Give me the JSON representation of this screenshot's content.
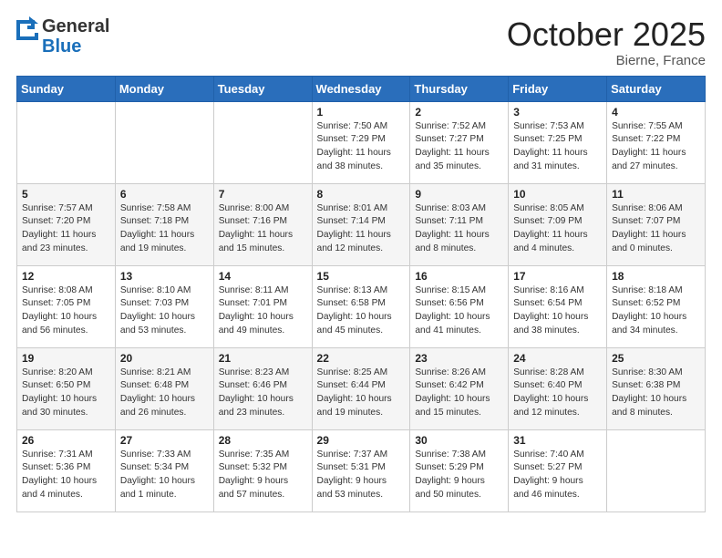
{
  "header": {
    "logo_general": "General",
    "logo_blue": "Blue",
    "month_title": "October 2025",
    "location": "Bierne, France"
  },
  "days_of_week": [
    "Sunday",
    "Monday",
    "Tuesday",
    "Wednesday",
    "Thursday",
    "Friday",
    "Saturday"
  ],
  "weeks": [
    [
      {
        "day": "",
        "content": ""
      },
      {
        "day": "",
        "content": ""
      },
      {
        "day": "",
        "content": ""
      },
      {
        "day": "1",
        "content": "Sunrise: 7:50 AM\nSunset: 7:29 PM\nDaylight: 11 hours\nand 38 minutes."
      },
      {
        "day": "2",
        "content": "Sunrise: 7:52 AM\nSunset: 7:27 PM\nDaylight: 11 hours\nand 35 minutes."
      },
      {
        "day": "3",
        "content": "Sunrise: 7:53 AM\nSunset: 7:25 PM\nDaylight: 11 hours\nand 31 minutes."
      },
      {
        "day": "4",
        "content": "Sunrise: 7:55 AM\nSunset: 7:22 PM\nDaylight: 11 hours\nand 27 minutes."
      }
    ],
    [
      {
        "day": "5",
        "content": "Sunrise: 7:57 AM\nSunset: 7:20 PM\nDaylight: 11 hours\nand 23 minutes."
      },
      {
        "day": "6",
        "content": "Sunrise: 7:58 AM\nSunset: 7:18 PM\nDaylight: 11 hours\nand 19 minutes."
      },
      {
        "day": "7",
        "content": "Sunrise: 8:00 AM\nSunset: 7:16 PM\nDaylight: 11 hours\nand 15 minutes."
      },
      {
        "day": "8",
        "content": "Sunrise: 8:01 AM\nSunset: 7:14 PM\nDaylight: 11 hours\nand 12 minutes."
      },
      {
        "day": "9",
        "content": "Sunrise: 8:03 AM\nSunset: 7:11 PM\nDaylight: 11 hours\nand 8 minutes."
      },
      {
        "day": "10",
        "content": "Sunrise: 8:05 AM\nSunset: 7:09 PM\nDaylight: 11 hours\nand 4 minutes."
      },
      {
        "day": "11",
        "content": "Sunrise: 8:06 AM\nSunset: 7:07 PM\nDaylight: 11 hours\nand 0 minutes."
      }
    ],
    [
      {
        "day": "12",
        "content": "Sunrise: 8:08 AM\nSunset: 7:05 PM\nDaylight: 10 hours\nand 56 minutes."
      },
      {
        "day": "13",
        "content": "Sunrise: 8:10 AM\nSunset: 7:03 PM\nDaylight: 10 hours\nand 53 minutes."
      },
      {
        "day": "14",
        "content": "Sunrise: 8:11 AM\nSunset: 7:01 PM\nDaylight: 10 hours\nand 49 minutes."
      },
      {
        "day": "15",
        "content": "Sunrise: 8:13 AM\nSunset: 6:58 PM\nDaylight: 10 hours\nand 45 minutes."
      },
      {
        "day": "16",
        "content": "Sunrise: 8:15 AM\nSunset: 6:56 PM\nDaylight: 10 hours\nand 41 minutes."
      },
      {
        "day": "17",
        "content": "Sunrise: 8:16 AM\nSunset: 6:54 PM\nDaylight: 10 hours\nand 38 minutes."
      },
      {
        "day": "18",
        "content": "Sunrise: 8:18 AM\nSunset: 6:52 PM\nDaylight: 10 hours\nand 34 minutes."
      }
    ],
    [
      {
        "day": "19",
        "content": "Sunrise: 8:20 AM\nSunset: 6:50 PM\nDaylight: 10 hours\nand 30 minutes."
      },
      {
        "day": "20",
        "content": "Sunrise: 8:21 AM\nSunset: 6:48 PM\nDaylight: 10 hours\nand 26 minutes."
      },
      {
        "day": "21",
        "content": "Sunrise: 8:23 AM\nSunset: 6:46 PM\nDaylight: 10 hours\nand 23 minutes."
      },
      {
        "day": "22",
        "content": "Sunrise: 8:25 AM\nSunset: 6:44 PM\nDaylight: 10 hours\nand 19 minutes."
      },
      {
        "day": "23",
        "content": "Sunrise: 8:26 AM\nSunset: 6:42 PM\nDaylight: 10 hours\nand 15 minutes."
      },
      {
        "day": "24",
        "content": "Sunrise: 8:28 AM\nSunset: 6:40 PM\nDaylight: 10 hours\nand 12 minutes."
      },
      {
        "day": "25",
        "content": "Sunrise: 8:30 AM\nSunset: 6:38 PM\nDaylight: 10 hours\nand 8 minutes."
      }
    ],
    [
      {
        "day": "26",
        "content": "Sunrise: 7:31 AM\nSunset: 5:36 PM\nDaylight: 10 hours\nand 4 minutes."
      },
      {
        "day": "27",
        "content": "Sunrise: 7:33 AM\nSunset: 5:34 PM\nDaylight: 10 hours\nand 1 minute."
      },
      {
        "day": "28",
        "content": "Sunrise: 7:35 AM\nSunset: 5:32 PM\nDaylight: 9 hours\nand 57 minutes."
      },
      {
        "day": "29",
        "content": "Sunrise: 7:37 AM\nSunset: 5:31 PM\nDaylight: 9 hours\nand 53 minutes."
      },
      {
        "day": "30",
        "content": "Sunrise: 7:38 AM\nSunset: 5:29 PM\nDaylight: 9 hours\nand 50 minutes."
      },
      {
        "day": "31",
        "content": "Sunrise: 7:40 AM\nSunset: 5:27 PM\nDaylight: 9 hours\nand 46 minutes."
      },
      {
        "day": "",
        "content": ""
      }
    ]
  ]
}
